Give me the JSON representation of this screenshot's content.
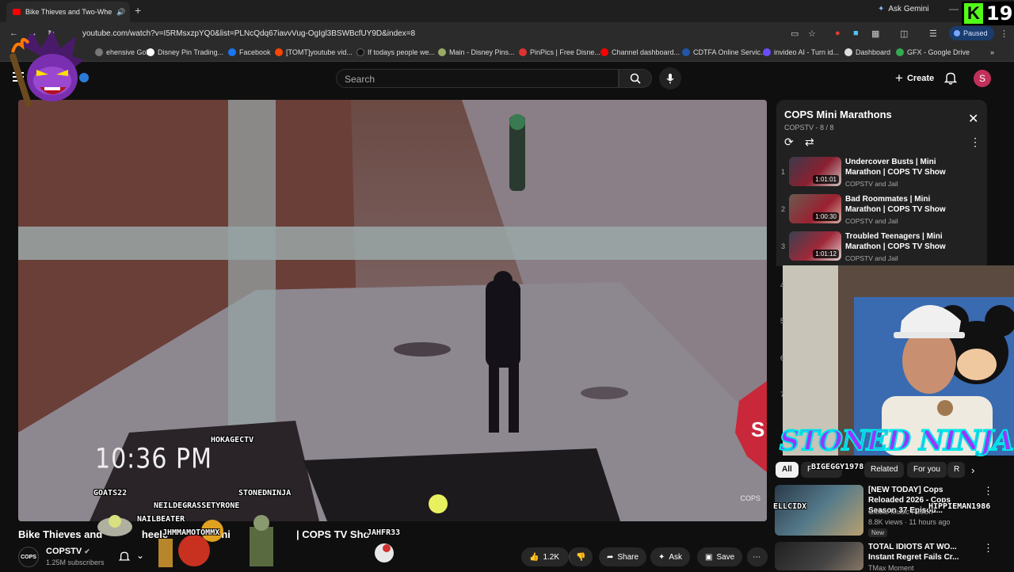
{
  "browser": {
    "tab_title": "Bike Thieves and Two-Whe",
    "new_tab": "+",
    "ask_gemini": "Ask Gemini",
    "url": "youtube.com/watch?v=I5RMsxzpYQ0&list=PLNcQdq67iavvVug-OgIgl3BSWBcfUY9D&index=8",
    "profile_status": "Paused",
    "kick_count": "19",
    "bookmarks": [
      {
        "label": "ehensive Gol...",
        "color": "#888888"
      },
      {
        "label": "Disney Pin Trading...",
        "color": "#ffffff"
      },
      {
        "label": "Facebook",
        "color": "#1877f2"
      },
      {
        "label": "[TOMT]youtube vid...",
        "color": "#ff4500"
      },
      {
        "label": "If todays people we...",
        "color": "#111111"
      },
      {
        "label": "Main - Disney Pins...",
        "color": "#99aa66"
      },
      {
        "label": "PinPics | Free Disne...",
        "color": "#dd3333"
      },
      {
        "label": "Channel dashboard...",
        "color": "#ff0000"
      },
      {
        "label": "CDTFA Online Servic...",
        "color": "#2255aa"
      },
      {
        "label": "invideo AI - Turn id...",
        "color": "#6a4cff"
      },
      {
        "label": "Dashboard",
        "color": "#dddddd"
      },
      {
        "label": "GFX - Google Drive",
        "color": "#34a853"
      }
    ]
  },
  "youtube": {
    "search_placeholder": "Search",
    "create_label": "Create",
    "avatar_letter": "S"
  },
  "video": {
    "timestamp_overlay": "10:36 PM",
    "watermark": "COPS",
    "title_start": "Bike Thieves and",
    "title_mid": "heele",
    "title_mini": "ini",
    "title_end": "| COPS TV Sho",
    "chat_names": [
      "HOKAGECTV",
      "GOATS22",
      "STONEDNINJA",
      "NEILDEGRASSETYRONE",
      "NAILBEATER",
      "JHMMAMOTOMMX",
      "JAHFR33"
    ]
  },
  "channel": {
    "name": "COPSTV",
    "subscribers": "1.25M subscribers",
    "avatar_text": "COPS"
  },
  "actions": {
    "likes": "1.2K",
    "share": "Share",
    "ask": "Ask",
    "save": "Save"
  },
  "playlist": {
    "title": "COPS Mini Marathons",
    "subtitle": "COPSTV - 8 / 8",
    "items": [
      {
        "index": "1",
        "title": "Undercover Busts | Mini Marathon | COPS TV Show",
        "channel": "COPSTV and Jail",
        "duration": "1:01:01"
      },
      {
        "index": "2",
        "title": "Bad Roommates | Mini Marathon | COPS TV Show",
        "channel": "COPSTV and Jail",
        "duration": "1:00:30"
      },
      {
        "index": "3",
        "title": "Troubled Teenagers | Mini Marathon | COPS TV Show",
        "channel": "COPSTV and Jail",
        "duration": "1:01:12"
      }
    ],
    "side_numbers": [
      "4",
      "5",
      "6",
      "7"
    ]
  },
  "stream_overlay": {
    "title": "STONED NINJA",
    "chat_names": [
      "BIGEGGY1978",
      "ELLCIDX",
      "HIPPIEMAN1986"
    ]
  },
  "chips": {
    "all": "All",
    "from": "F",
    "related": "Related",
    "for_you": "For you",
    "more": "R"
  },
  "recommendations": [
    {
      "title": "[NEW TODAY] Cops Reloaded 2026 - Cops Season 37 Episod...",
      "channel": "Global Music Fusion",
      "meta": "8.8K views · 11 hours ago",
      "badge": "New"
    },
    {
      "title": "TOTAL IDIOTS AT WO... Instant Regret Fails Cr...",
      "channel": "TMax Moment",
      "meta": "",
      "badge": ""
    }
  ]
}
